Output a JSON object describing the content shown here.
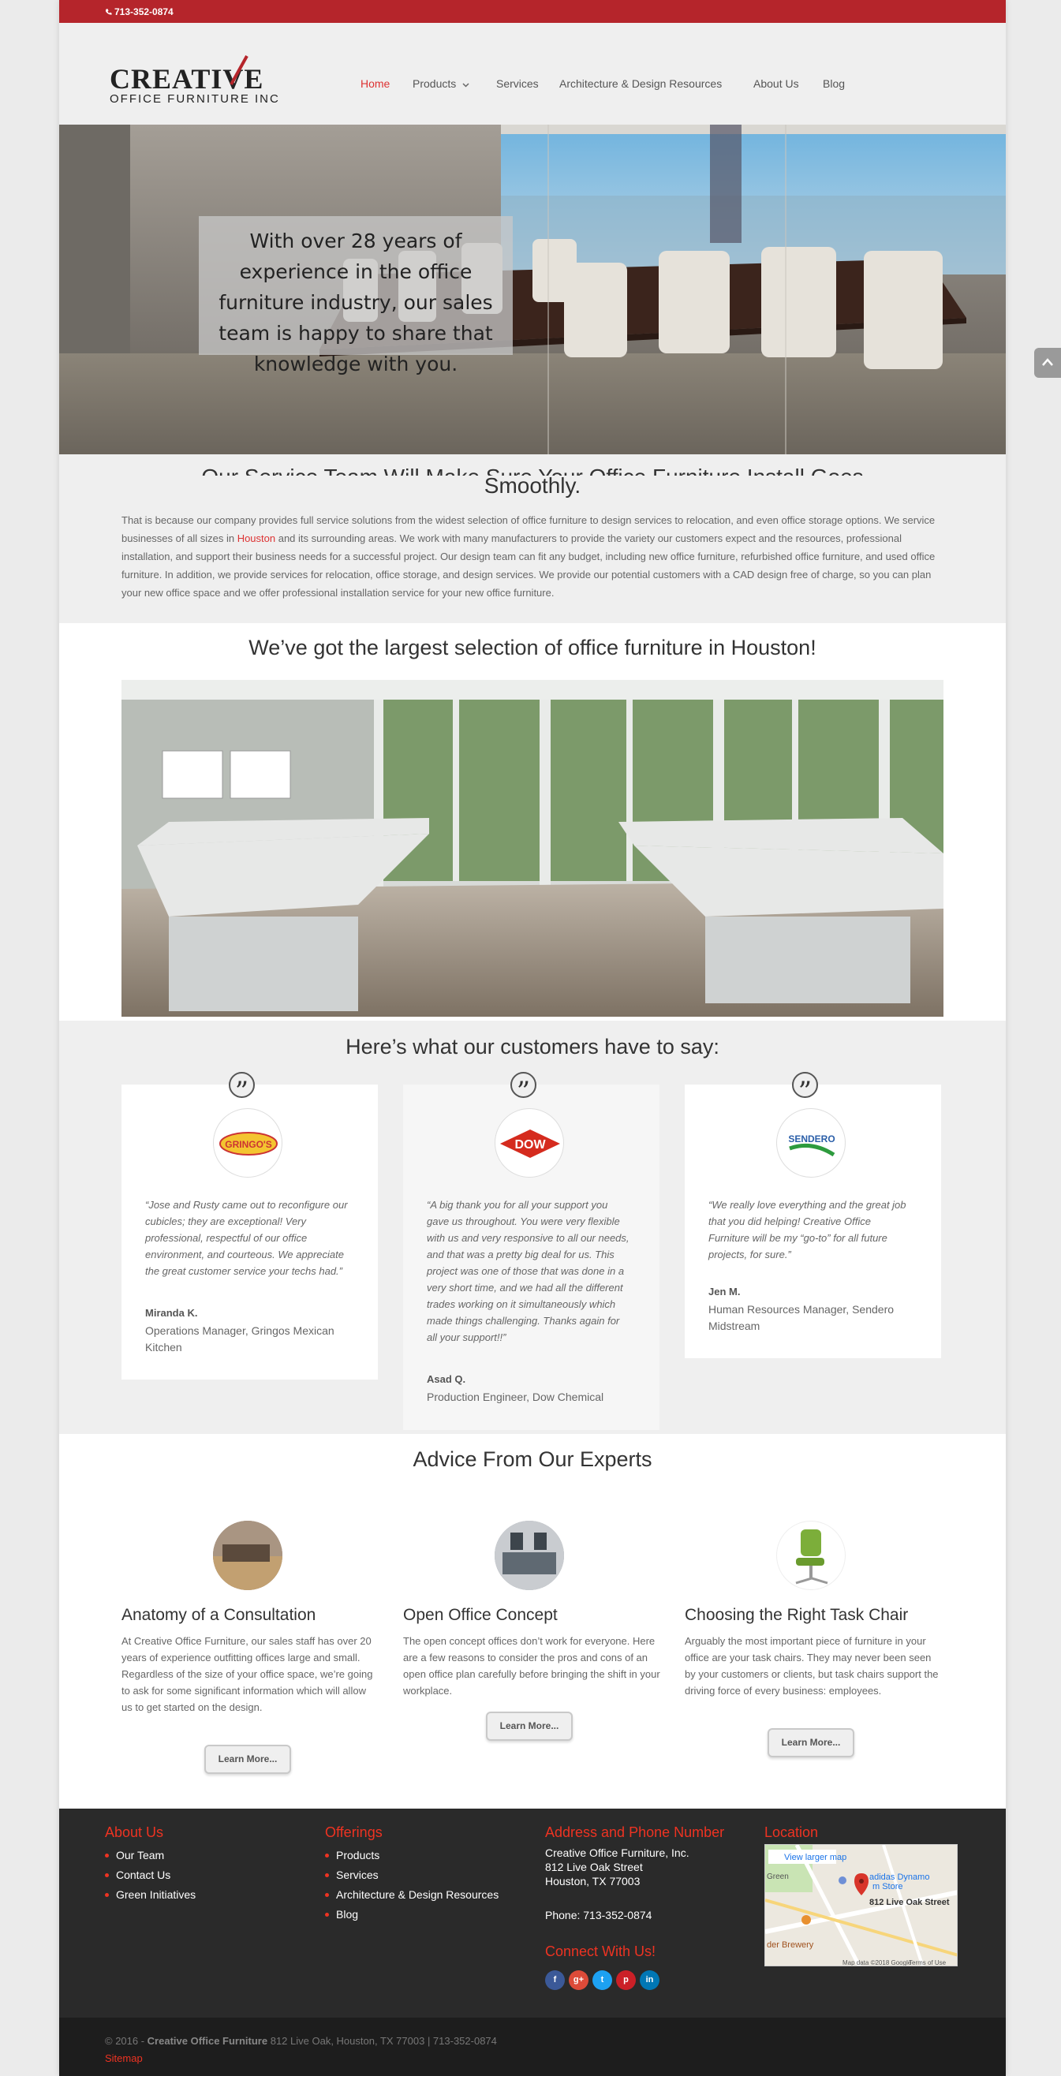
{
  "topbar": {
    "phone": "713-352-0874"
  },
  "logo": {
    "line1": "CREATIVE",
    "line2": "OFFICE FURNITURE INC"
  },
  "nav": [
    {
      "label": "Home",
      "active": true
    },
    {
      "label": "Products",
      "dropdown": true
    },
    {
      "label": "Services"
    },
    {
      "label": "Architecture & Design Resources"
    },
    {
      "label": "About Us"
    },
    {
      "label": "Blog"
    }
  ],
  "hero": {
    "text": "With over 28 years of experience in the office furniture industry, our sales team is happy to share that knowledge with you."
  },
  "intro": {
    "heading_cut": "Our Service Team Will Make Sure Your Office Furniture Install Goes",
    "heading": "Smoothly.",
    "p_part1": "That is because our company provides full service solutions from the widest selection of office furniture to design services to relocation, and even office storage options. We service businesses of all sizes in ",
    "p_link": "Houston",
    "p_part2": " and its surrounding areas. We work with many manufacturers to provide the variety our customers expect and the resources, professional installation, and support their business needs for a successful project.  Our design team can fit any budget, including new office furniture, refurbished office furniture, and used office furniture. In addition, we provide services for relocation, office storage, and design services. We provide our potential customers with a CAD design free of charge, so you can plan your new office space and we offer professional installation service for your new office furniture."
  },
  "selection": {
    "heading": "We’ve got the largest selection of office furniture in Houston!"
  },
  "testimonials": {
    "heading": "Here’s what our customers have to say:",
    "items": [
      {
        "logo": "GRINGO'S",
        "quote": "“Jose and Rusty came out to reconfigure our cubicles; they are exceptional! Very professional, respectful of our office environment, and courteous. We appreciate the great customer service your techs had.”",
        "name": "Miranda K.",
        "role": "Operations Manager, Gringos Mexican Kitchen"
      },
      {
        "logo": "DOW",
        "quote": "“A big thank you for all your support you gave us throughout. You were very flexible with us and very responsive to all our needs, and that was a pretty big deal for us. This project was one of those that was done in a very short time, and we had all the different trades working on it simultaneously which made things challenging. Thanks again for all your support!!”",
        "name": "Asad Q.",
        "role": "Production Engineer, Dow Chemical"
      },
      {
        "logo": "SENDERO",
        "quote": "“We really love everything and the great job that you did helping! Creative Office Furniture will be my “go-to” for all future projects, for sure.”",
        "name": "Jen M.",
        "role": "Human Resources Manager, Sendero Midstream"
      }
    ]
  },
  "advice": {
    "heading": "Advice From Our Experts",
    "items": [
      {
        "title": "Anatomy of a Consultation",
        "body": "At Creative Office Furniture, our sales staff has over 20 years of experience outfitting offices large and small. Regardless of the size of your office space, we’re going to ask for some significant information which will allow us to get started on the design.",
        "button": "Learn More..."
      },
      {
        "title": "Open Office Concept",
        "body": "The open concept offices don’t work for everyone. Here are a few reasons to consider the pros and cons of an open office plan carefully before bringing the shift in your workplace.",
        "button": "Learn More..."
      },
      {
        "title": "Choosing the Right Task Chair",
        "body": "Arguably the most important piece of furniture in your office are your task chairs. They may never been seen by your customers or clients, but task chairs support the driving force of every business: employees.",
        "button": "Learn More..."
      }
    ]
  },
  "footer": {
    "about": {
      "title": "About Us",
      "links": [
        "Our Team",
        "Contact Us",
        "Green Initiatives"
      ]
    },
    "offerings": {
      "title": "Offerings",
      "links": [
        "Products",
        "Services",
        "Architecture & Design Resources",
        "Blog"
      ]
    },
    "address": {
      "title": "Address and Phone Number",
      "line1": "Creative Office Furniture, Inc.",
      "line2": "812 Live Oak Street",
      "line3": "Houston, TX 77003",
      "phone": "Phone: 713-352-0874"
    },
    "connect": "Connect With Us!",
    "social": [
      "f",
      "g+",
      "t",
      "p",
      "in"
    ],
    "location": {
      "title": "Location",
      "view_larger": "View larger map",
      "pin_label": "812 Live Oak Street",
      "poi": "adidas Dynamo",
      "poi2": "m Store",
      "brewery": "der Brewery",
      "green": "Green",
      "credit": "Map data ©2018 Google",
      "terms": "Terms of Use"
    }
  },
  "bottombar": {
    "year": "© 2016 - ",
    "company": "Creative Office Furniture",
    "rest": " 812 Live Oak, Houston, TX 77003 | 713-352-0874",
    "sitemap": "Sitemap"
  },
  "colors": {
    "brand_red": "#b5252b",
    "accent_red": "#dd3333",
    "footer_bg": "#2a2a2a"
  }
}
